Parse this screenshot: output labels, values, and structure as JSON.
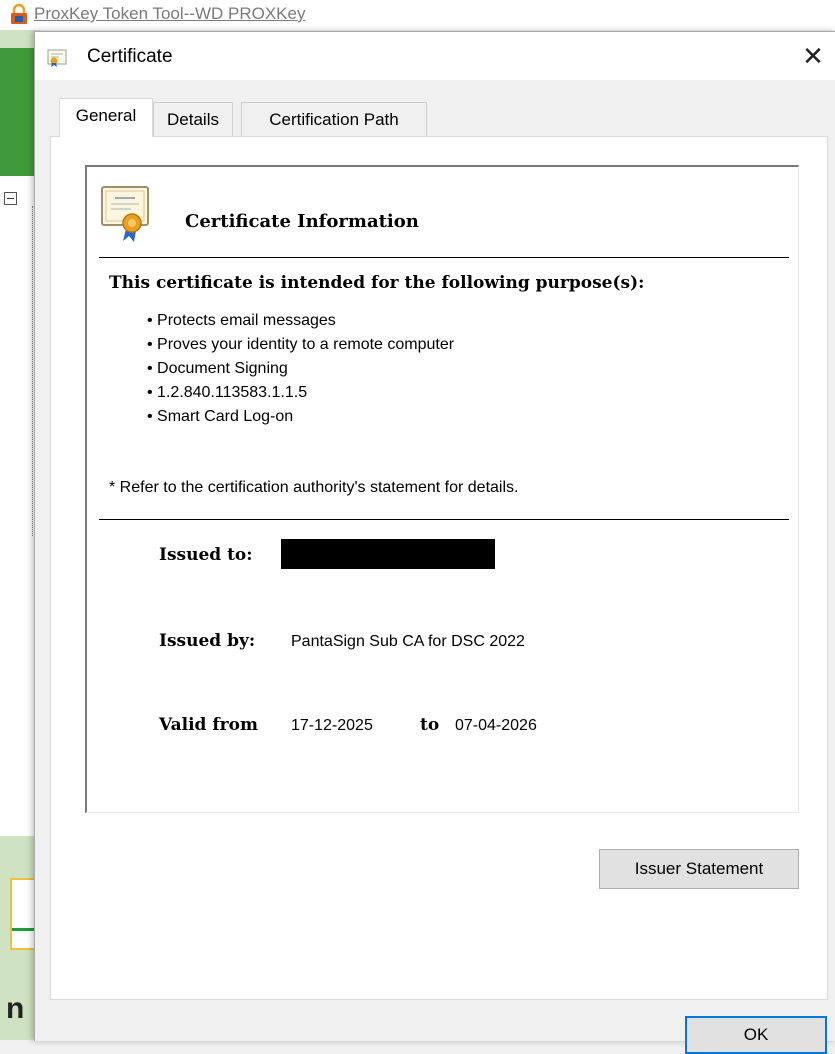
{
  "background_app": {
    "title": "ProxKey Token Tool--WD PROXKey",
    "partial_text": "n"
  },
  "dialog": {
    "title": "Certificate",
    "close_glyph": "✕",
    "tabs": [
      {
        "label": "General",
        "active": true
      },
      {
        "label": "Details",
        "active": false
      },
      {
        "label": "Certification Path",
        "active": false
      }
    ],
    "info": {
      "heading": "Certificate Information",
      "purpose_heading": "This certificate is intended for the following purpose(s):",
      "purposes": [
        "Protects email messages",
        "Proves your identity to a remote computer",
        "Document Signing",
        "1.2.840.113583.1.1.5",
        "Smart Card Log-on"
      ],
      "footnote": "* Refer to the certification authority's statement for details.",
      "issued_to_label": "Issued to:",
      "issued_by_label": "Issued by:",
      "issued_by_value": "PantaSign Sub CA for DSC 2022",
      "valid_from_label": "Valid from",
      "valid_from_value": "17-12-2025",
      "valid_to_label": "to",
      "valid_to_value": "07-04-2026"
    },
    "buttons": {
      "issuer_statement": "Issuer Statement",
      "ok": "OK"
    }
  },
  "icons": [
    "lock-app-icon",
    "certificate-icon",
    "close-icon"
  ],
  "colors": {
    "accent": "#0078d7",
    "green": "#3f9a3a",
    "dialog_bg": "#f0f0f0"
  }
}
